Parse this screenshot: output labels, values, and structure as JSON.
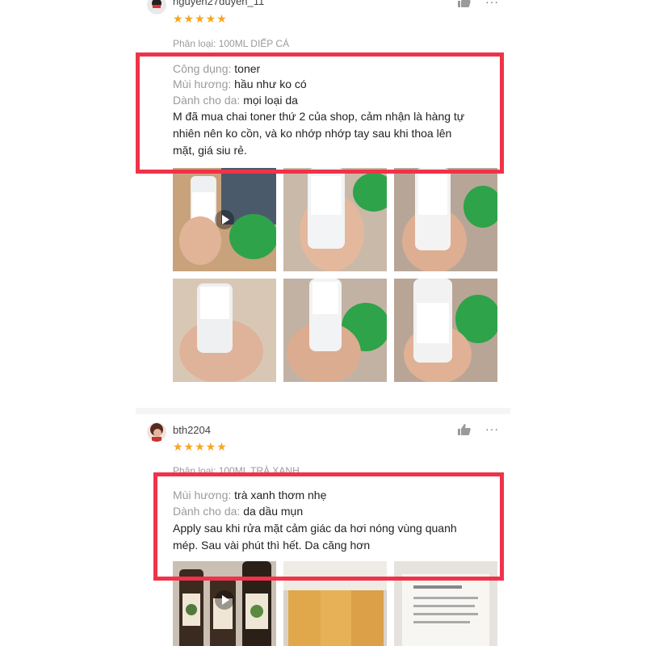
{
  "colors": {
    "star": "#f5a623",
    "highlight": "#f0324a",
    "muted": "#9b9b9b"
  },
  "reviews": [
    {
      "username": "nguyen27duyen_11",
      "stars": "★★★★★",
      "variant": "Phân loại: 100ML DIẾP CÁ",
      "attrs": [
        {
          "key": "Công dụng:",
          "value": "toner"
        },
        {
          "key": "Mùi hương:",
          "value": "hầu như ko có"
        },
        {
          "key": "Dành cho da:",
          "value": "mọi loại da"
        }
      ],
      "body_lines": [
        "M đã mua chai toner thứ 2 của shop, cảm nhận là hàng tự",
        "nhiên nên ko cồn, và ko nhớp nhớp tay sau khi thoa lên",
        "mặt, giá siu rẻ."
      ],
      "like_icon": "thumbs-up-icon",
      "more_label": "···"
    },
    {
      "username": "bth2204",
      "stars": "★★★★★",
      "variant": "Phân loại: 100ML TRÀ XANH",
      "attrs": [
        {
          "key": "Mùi hương:",
          "value": "trà xanh thơm nhẹ"
        },
        {
          "key": "Dành cho da:",
          "value": "da dầu mụn"
        }
      ],
      "body_lines": [
        "Apply sau khi rửa mặt cảm giác da hơi nóng vùng quanh",
        "mép. Sau vài phút thì hết. Da căng hơn"
      ],
      "like_icon": "thumbs-up-icon",
      "more_label": "···"
    }
  ]
}
